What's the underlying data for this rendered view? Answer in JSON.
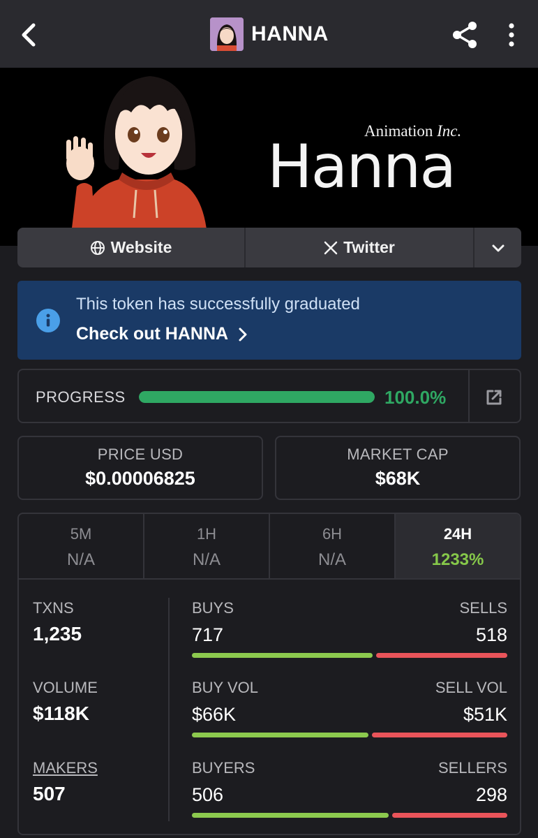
{
  "header": {
    "title": "HANNA",
    "icons": {
      "back": "chevron-left-icon",
      "share": "share-icon",
      "more": "more-vertical-icon"
    }
  },
  "banner": {
    "subtitle_main": "Animation",
    "subtitle_italic": "Inc.",
    "logo_text": "Hanna"
  },
  "links": {
    "website_label": "Website",
    "twitter_label": "Twitter"
  },
  "notice": {
    "message": "This token has successfully graduated",
    "link_label": "Check out HANNA"
  },
  "progress": {
    "label": "PROGRESS",
    "value_text": "100.0%",
    "fraction": 1.0,
    "color": "#2fa863"
  },
  "stats": {
    "price_label": "PRICE USD",
    "price_value": "$0.00006825",
    "mcap_label": "MARKET CAP",
    "mcap_value": "$68K"
  },
  "timeframes": [
    {
      "label": "5M",
      "value": "N/A"
    },
    {
      "label": "1H",
      "value": "N/A"
    },
    {
      "label": "6H",
      "value": "N/A"
    },
    {
      "label": "24H",
      "value": "1233%"
    }
  ],
  "metrics": {
    "txns_label": "TXNS",
    "txns_value": "1,235",
    "volume_label": "VOLUME",
    "volume_value": "$118K",
    "makers_label": "MAKERS",
    "makers_value": "507"
  },
  "ratios": [
    {
      "left_label": "BUYS",
      "right_label": "SELLS",
      "left_value": "717",
      "right_value": "518",
      "left_share": 0.58
    },
    {
      "left_label": "BUY VOL",
      "right_label": "SELL VOL",
      "left_value": "$66K",
      "right_value": "$51K",
      "left_share": 0.565
    },
    {
      "left_label": "BUYERS",
      "right_label": "SELLERS",
      "left_value": "506",
      "right_value": "298",
      "left_share": 0.63
    }
  ],
  "colors": {
    "buy": "#8cc94e",
    "sell": "#e9545a",
    "accent_positive": "#86c84a",
    "info_bg": "#1a3a66"
  }
}
